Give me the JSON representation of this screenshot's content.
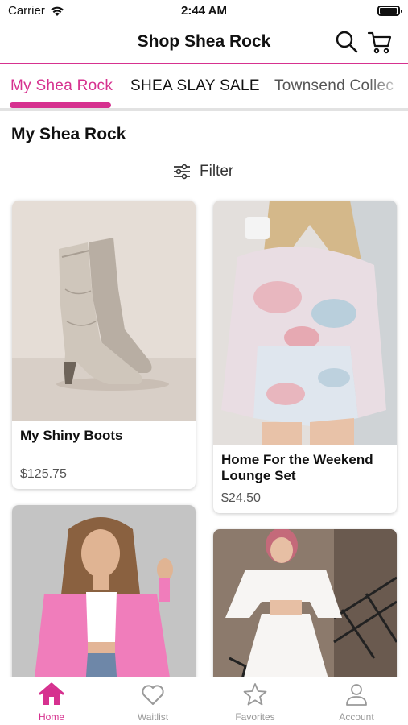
{
  "status": {
    "carrier": "Carrier",
    "time": "2:44 AM"
  },
  "header": {
    "title": "Shop Shea Rock"
  },
  "tabs": [
    {
      "label": "My Shea Rock"
    },
    {
      "label": "SHEA SLAY SALE"
    },
    {
      "label": "Townsend Collec"
    }
  ],
  "section_title": "My Shea Rock",
  "filter_label": "Filter",
  "products": [
    {
      "name": "My Shiny Boots",
      "price": "$125.75"
    },
    {
      "name": "Home For the Weekend Lounge Set",
      "price": "$24.50"
    }
  ],
  "tabbar": [
    {
      "label": "Home"
    },
    {
      "label": "Waitlist"
    },
    {
      "label": "Favorites"
    },
    {
      "label": "Account"
    }
  ],
  "colors": {
    "accent": "#d6318f"
  }
}
